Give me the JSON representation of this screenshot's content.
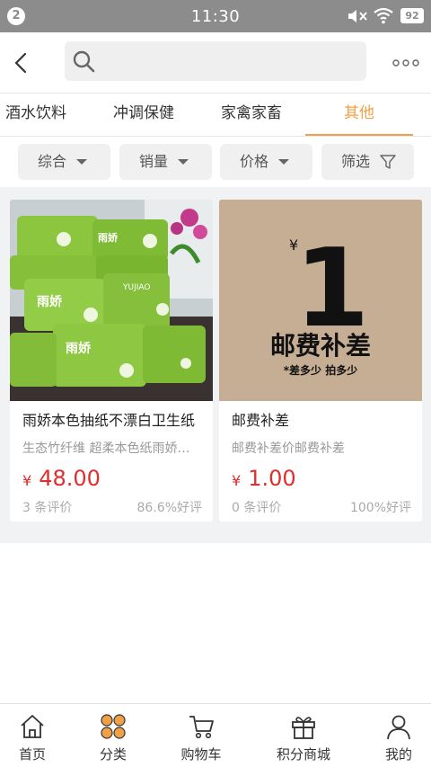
{
  "status_bar": {
    "badge": "2",
    "time": "11:30",
    "battery": "92"
  },
  "header": {
    "search": {
      "value": "",
      "placeholder": ""
    }
  },
  "tabs": [
    {
      "label": "酒水饮料",
      "active": false
    },
    {
      "label": "冲调保健",
      "active": false
    },
    {
      "label": "家禽家畜",
      "active": false
    },
    {
      "label": "其他",
      "active": true
    }
  ],
  "filters": [
    {
      "label": "综合",
      "icon": "caret-down-icon"
    },
    {
      "label": "销量",
      "icon": "caret-down-icon"
    },
    {
      "label": "价格",
      "icon": "caret-down-icon"
    },
    {
      "label": "筛选",
      "icon": "funnel-icon"
    }
  ],
  "products": [
    {
      "title": "雨娇本色抽纸不漂白卫生纸",
      "description": "生态竹纤维 超柔本色纸雨娇抽纸",
      "currency": "¥",
      "price": "48.00",
      "reviews": "3 条评价",
      "rating": "86.6%好评",
      "image": {
        "brand_text": "雨娇",
        "subtext": "YUJIAO"
      }
    },
    {
      "title": "邮费补差",
      "description": "邮费补差价邮费补差",
      "currency": "¥",
      "price": "1.00",
      "reviews": "0 条评价",
      "rating": "100%好评",
      "image": {
        "currency": "¥",
        "number": "1",
        "headline": "邮费补差",
        "subline": "*差多少 拍多少"
      }
    }
  ],
  "bottom_nav": [
    {
      "label": "首页",
      "icon": "home-icon",
      "active": false
    },
    {
      "label": "分类",
      "icon": "category-icon",
      "active": true
    },
    {
      "label": "购物车",
      "icon": "cart-icon",
      "active": false
    },
    {
      "label": "积分商城",
      "icon": "gift-icon",
      "active": false
    },
    {
      "label": "我的",
      "icon": "user-icon",
      "active": false
    }
  ],
  "colors": {
    "accent": "#f0a046",
    "price": "#e02d2d",
    "status_bar": "#8c8c8c",
    "product_green": "#8cc63f",
    "postage_bg": "#c5ae94"
  }
}
